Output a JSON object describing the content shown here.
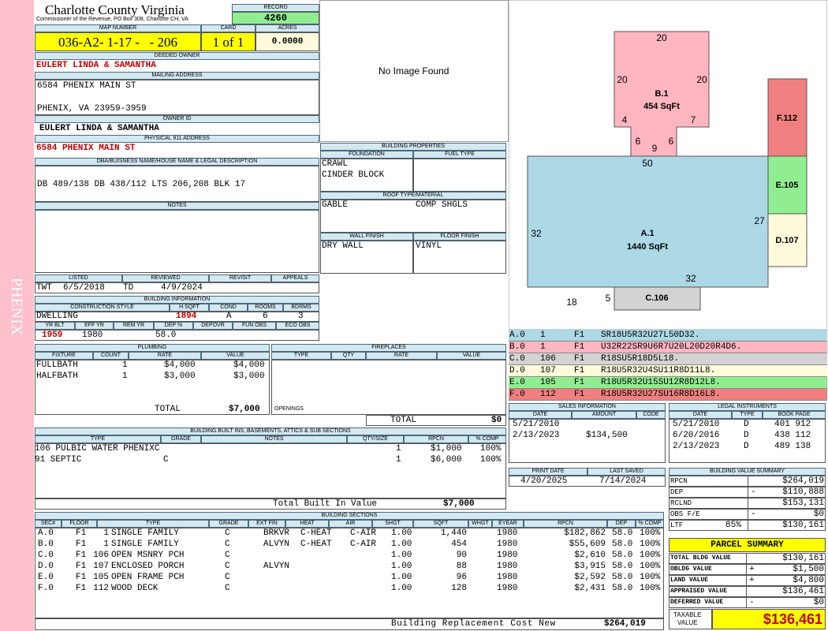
{
  "side_label": "PHENIX",
  "county": {
    "title": "Charlotte County Virginia",
    "subtitle": "Commissioner of the Revenue, PO Box 308, Charlotte CH, VA"
  },
  "record": {
    "label": "RECORD",
    "value": "4260"
  },
  "map": {
    "label": "MAP NUMBER",
    "value": "036-A2- 1-17 -   - 206",
    "card_label": "CARD",
    "card": "1 of 1",
    "acres_label": "ACRES",
    "acres": "0.0000"
  },
  "deeded_owner": {
    "label": "DEEDED OWNER",
    "value": "EULERT LINDA & SAMANTHA"
  },
  "mailing": {
    "label": "MAILING ADDRESS",
    "line1": "6584 PHENIX MAIN ST",
    "line2": "PHENIX, VA 23959-3959"
  },
  "owner_id": {
    "label": "OWNER ID",
    "value": "EULERT LINDA & SAMANTHA"
  },
  "physical": {
    "label": "PHYSICAL 911 ADDRESS",
    "value": "6584 PHENIX MAIN ST"
  },
  "dba": {
    "label": "DBA/BUISNESS NAME/HOUSE NAME & LEGAL DESCRIPTION",
    "value": "DB 489/138 DB 438/112 LTS 206,208 BLK 17"
  },
  "notes": {
    "label": "NOTES",
    "value": ""
  },
  "image_text": "No Image Found",
  "building_props": {
    "title": "BUILDING PROPERTIES",
    "foundation_label": "FOUNDATION",
    "fueltype_label": "FUEL TYPE",
    "foundation1": "CRAWL",
    "foundation2": "CINDER BLOCK",
    "roof_label": "ROOF TYPE/MATERIAL",
    "roof1": "GABLE",
    "roof2": "COMP SHGLS",
    "wall_label": "WALL FINISH",
    "floor_label": "FLOOR FINISH",
    "wall": "DRY WALL",
    "floor": "VINYL"
  },
  "listed": {
    "listed_label": "LISTED",
    "reviewed_label": "REVIEWED",
    "revisit_label": "REVISIT",
    "appeals_label": "APPEALS",
    "listed_by": "TWT",
    "listed_date": "6/5/2018",
    "reviewed_by": "TD",
    "reviewed_date": "4/9/2024"
  },
  "building_info": {
    "title": "BUILDING INFORMATION",
    "style_label": "CONSTRUCTION STYLE",
    "hsqft_label": "H SQFT",
    "cond_label": "COND",
    "rooms_label": "ROOMS",
    "bdrms_label": "BDRMS",
    "style": "DWELLING",
    "hsqft": "1894",
    "cond": "A",
    "rooms": "6",
    "bdrms": "3",
    "yrblt_label": "YR BLT",
    "effyr_label": "EFF YR",
    "remyr_label": "REM YR",
    "dep_label": "DEP %",
    "depovr_label": "DEPOVR",
    "funobs_label": "FUN OBS",
    "ecoobs_label": "ECO OBS",
    "yrblt": "1959",
    "effyr": "1980",
    "dep": "58.0"
  },
  "plumbing": {
    "title": "PLUMBING",
    "h_fixture": "FIXTURE",
    "h_count": "COUNT",
    "h_rate": "RATE",
    "h_value": "VALUE",
    "rows": [
      {
        "fixture": "FULLBATH",
        "count": "1",
        "rate": "$4,000",
        "value": "$4,000"
      },
      {
        "fixture": "HALFBATH",
        "count": "1",
        "rate": "$3,000",
        "value": "$3,000"
      }
    ],
    "total_label": "TOTAL",
    "total": "$7,000"
  },
  "fireplaces": {
    "title": "FIREPLACES",
    "h_type": "TYPE",
    "h_qty": "QTY",
    "h_rate": "RATE",
    "h_value": "VALUE",
    "openings_label": "OPENINGS",
    "total_label": "TOTAL",
    "total": "$0"
  },
  "builtins": {
    "title": "BUILDING BUILT INS, BASEMENTS, ATTICS & SUB SECTIONS",
    "h_type": "TYPE",
    "h_grade": "GRADE",
    "h_notes": "NOTES",
    "h_qty": "QTY/SIZE",
    "h_rpcn": "RPCN",
    "h_comp": "% COMP",
    "rows": [
      {
        "type": "106 PULBIC WATER PHENIXC",
        "grade": "",
        "qty": "1",
        "rpcn": "$1,000",
        "comp": "100%"
      },
      {
        "type": "91 SEPTIC",
        "grade": "C",
        "qty": "1",
        "rpcn": "$6,000",
        "comp": "100%"
      }
    ],
    "total_label": "Total Built In Value",
    "total": "$7,000"
  },
  "sketch": {
    "labels": {
      "a_name": "A.1",
      "a_area": "1440 SqFt",
      "b_name": "B.1",
      "b_area": "454 SqFt",
      "c_name": "C.106",
      "d_name": "D.107",
      "e_name": "E.105",
      "f_name": "F.112"
    },
    "dims": {
      "b_top": "20",
      "b_left": "20",
      "b_right": "20",
      "b_4": "4",
      "b_7": "7",
      "b_6l": "6",
      "b_9": "9",
      "b_6r": "6",
      "a_top": "50",
      "a_left": "32",
      "a_right": "27",
      "a_32": "32",
      "a_18": "18",
      "a_5": "5"
    },
    "colors": {
      "a": "#add8e6",
      "b": "#ffb6c1",
      "c": "#d3d3d3",
      "d": "#fffadc",
      "e": "#90ee90",
      "f": "#f08080"
    }
  },
  "vectors": [
    {
      "code": "A.0",
      "num": "1",
      "floor": "F1",
      "vec": "SR18U5R32U27L50D32.",
      "color": "#add8e6"
    },
    {
      "code": "B.0",
      "num": "1",
      "floor": "F1",
      "vec": "U32R22SR9U6R7U20L20D20R4D6.",
      "color": "#ffb6c1"
    },
    {
      "code": "C.0",
      "num": "106",
      "floor": "F1",
      "vec": "R18SU5R18D5L18.",
      "color": "#d3d3d3"
    },
    {
      "code": "D.0",
      "num": "107",
      "floor": "F1",
      "vec": "R18U5R32U4SU11R8D11L8.",
      "color": "#fffadc"
    },
    {
      "code": "E.0",
      "num": "105",
      "floor": "F1",
      "vec": "R18U5R32U15SU12R8D12L8.",
      "color": "#90ee90"
    },
    {
      "code": "F.0",
      "num": "112",
      "floor": "F1",
      "vec": "R18U5R32U27SU16R8D16L8.",
      "color": "#f08080"
    }
  ],
  "sales": {
    "title": "SALES INFORMATION",
    "h_date": "DATE",
    "h_amount": "AMOUNT",
    "h_code": "CODE",
    "rows": [
      {
        "date": "5/21/2010",
        "amount": "",
        "code": ""
      },
      {
        "date": "2/13/2023",
        "amount": "$134,500",
        "code": ""
      }
    ]
  },
  "legal": {
    "title": "LEGAL INSTRUMENTS",
    "h_date": "DATE",
    "h_type": "TYPE",
    "h_book": "BOOK PAGE",
    "rows": [
      {
        "date": "5/21/2010",
        "type": "D",
        "book": "401 912"
      },
      {
        "date": "6/20/2016",
        "type": "D",
        "book": "438 112"
      },
      {
        "date": "2/13/2023",
        "type": "D",
        "book": "489 138"
      }
    ]
  },
  "print": {
    "print_label": "PRINT DATE",
    "saved_label": "LAST SAVED",
    "print_date": "4/20/2025",
    "saved_date": "7/14/2024"
  },
  "bvs": {
    "title": "BUILDING VALUE SUMMARY",
    "rows": [
      {
        "label": "RPCN",
        "sign": "",
        "value": "$264,019"
      },
      {
        "label": "DEP",
        "sign": "-",
        "value": "$110,888"
      },
      {
        "label": "RCLND",
        "sign": "",
        "value": "$153,131"
      },
      {
        "label": "OBS F/E",
        "sign": "-",
        "value": "$0"
      },
      {
        "label": "LTF",
        "sign": "",
        "value": "$130,161",
        "pct": "85%"
      }
    ]
  },
  "parcel": {
    "title": "PARCEL SUMMARY",
    "rows": [
      {
        "label": "TOTAL BLDG VALUE",
        "sign": "",
        "value": "$130,161"
      },
      {
        "label": "OBLDG VALUE",
        "sign": "+",
        "value": "$1,500"
      },
      {
        "label": "LAND VALUE",
        "sign": "+",
        "value": "$4,800"
      },
      {
        "label": "APPRAISED VALUE",
        "sign": "",
        "value": "$136,461"
      },
      {
        "label": "DEFERRED VALUE",
        "sign": "-",
        "value": "$0"
      }
    ],
    "taxable_label1": "TAXABLE",
    "taxable_label2": "VALUE",
    "taxable": "$136,461"
  },
  "sections": {
    "title": "BUILDING SECTIONS",
    "h": {
      "sec": "SEC#",
      "floor": "FLOOR",
      "type": "TYPE",
      "grade": "GRADE",
      "extfin": "EXT FIN",
      "heat": "HEAT",
      "air": "AIR",
      "shgt": "SHGT",
      "sqft": "SQFT",
      "whgt": "WHGT",
      "eyear": "EYEAR",
      "rpcn": "RPCN",
      "dep": "DEP",
      "comp": "% COMP"
    },
    "rows": [
      {
        "sec": "A.0",
        "floor": "F1",
        "num": "1",
        "type": "SINGLE FAMILY",
        "grade": "C",
        "extfin": "BRKVR",
        "heat": "C-HEAT",
        "air": "C-AIR",
        "shgt": "1.00",
        "sqft": "1,440",
        "eyear": "1980",
        "rpcn": "$182,862",
        "dep": "58.0",
        "comp": "100%"
      },
      {
        "sec": "B.0",
        "floor": "F1",
        "num": "1",
        "type": "SINGLE FAMILY",
        "grade": "C",
        "extfin": "ALVYN",
        "heat": "C-HEAT",
        "air": "C-AIR",
        "shgt": "1.00",
        "sqft": "454",
        "eyear": "1980",
        "rpcn": "$55,609",
        "dep": "58.0",
        "comp": "100%"
      },
      {
        "sec": "C.0",
        "floor": "F1",
        "num": "106",
        "type": "OPEN MSNRY PCH",
        "grade": "C",
        "extfin": "",
        "heat": "",
        "air": "",
        "shgt": "1.00",
        "sqft": "90",
        "eyear": "1980",
        "rpcn": "$2,610",
        "dep": "58.0",
        "comp": "100%"
      },
      {
        "sec": "D.0",
        "floor": "F1",
        "num": "107",
        "type": "ENCLOSED PORCH",
        "grade": "C",
        "extfin": "ALVYN",
        "heat": "",
        "air": "",
        "shgt": "1.00",
        "sqft": "88",
        "eyear": "1980",
        "rpcn": "$3,915",
        "dep": "58.0",
        "comp": "100%"
      },
      {
        "sec": "E.0",
        "floor": "F1",
        "num": "105",
        "type": "OPEN FRAME PCH",
        "grade": "C",
        "extfin": "",
        "heat": "",
        "air": "",
        "shgt": "1.00",
        "sqft": "96",
        "eyear": "1980",
        "rpcn": "$2,592",
        "dep": "58.0",
        "comp": "100%"
      },
      {
        "sec": "F.0",
        "floor": "F1",
        "num": "112",
        "type": "WOOD DECK",
        "grade": "C",
        "extfin": "",
        "heat": "",
        "air": "",
        "shgt": "1.00",
        "sqft": "128",
        "eyear": "1980",
        "rpcn": "$2,431",
        "dep": "58.0",
        "comp": "100%"
      }
    ],
    "brcn_label": "Building Replacement Cost New",
    "brcn": "$264,019"
  }
}
